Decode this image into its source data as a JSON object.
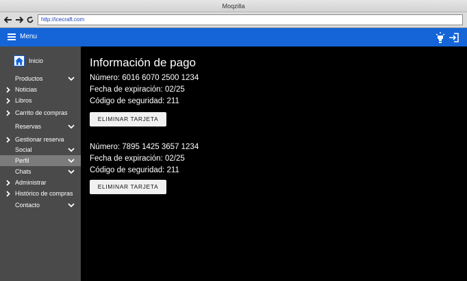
{
  "window": {
    "title": "Moqzilla"
  },
  "browser": {
    "url": "http://icecraft.com"
  },
  "appbar": {
    "menu_label": "Menu"
  },
  "sidebar": {
    "home_label": "Inicio",
    "items": [
      {
        "label": "Productos",
        "caret": "down"
      },
      {
        "label": "Noticias",
        "caret": "right"
      },
      {
        "label": "Libros",
        "caret": "right"
      },
      {
        "label": "Carrito de compras",
        "caret": "right"
      },
      {
        "label": "Reservas",
        "caret": "down"
      },
      {
        "label": "Gestionar reserva",
        "caret": "right"
      },
      {
        "label": "Social",
        "caret": "down"
      },
      {
        "label": "Perfil",
        "caret": "down",
        "active": true
      },
      {
        "label": "Chats",
        "caret": "down"
      },
      {
        "label": "Administrar",
        "caret": "right"
      },
      {
        "label": "Histórico de compras",
        "caret": "right"
      },
      {
        "label": "Contacto",
        "caret": "down"
      }
    ]
  },
  "main": {
    "title": "Información de pago",
    "cards": [
      {
        "number": "Número: 6016 6070 2500 1234",
        "expiry": "Fecha de expiración: 02/25",
        "security": "Código de seguridad: 211",
        "button": "ELIMINAR TARJETA"
      },
      {
        "number": "Número: 7895 1425 3657 1234",
        "expiry": "Fecha de expiración: 02/25",
        "security": "Código de seguridad: 211",
        "button": "ELIMINAR TARJETA"
      }
    ]
  },
  "colors": {
    "appbar": "#1565d8",
    "sidebar": "#4a4a4a",
    "sidebar_active": "#7b7b7b",
    "main_bg": "#000000"
  }
}
